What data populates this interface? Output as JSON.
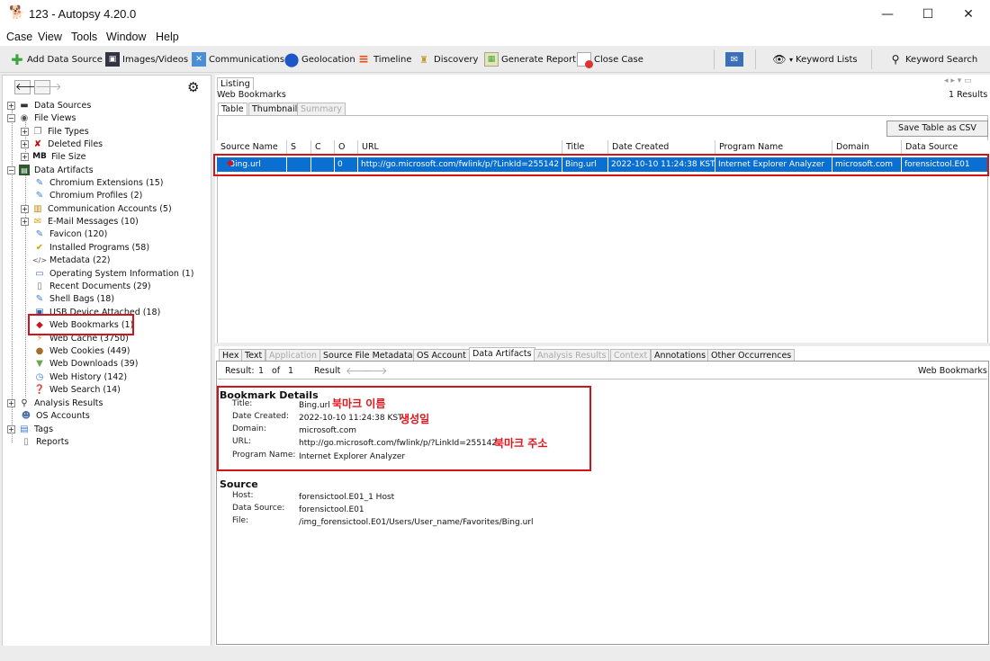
{
  "window": {
    "title": "123 - Autopsy 4.20.0",
    "minimize": "—",
    "maximize": "☐",
    "close": "✕"
  },
  "menu": [
    "Case",
    "View",
    "Tools",
    "Window",
    "Help"
  ],
  "toolbar": {
    "add_data_source": "Add Data Source",
    "images_videos": "Images/Videos",
    "communications": "Communications",
    "geolocation": "Geolocation",
    "timeline": "Timeline",
    "discovery": "Discovery",
    "generate_report": "Generate Report",
    "close_case": "Close Case",
    "keyword_lists": "Keyword Lists",
    "keyword_search": "Keyword Search"
  },
  "tree": {
    "data_sources": "Data Sources",
    "file_views": "File Views",
    "file_types": "File Types",
    "deleted_files": "Deleted Files",
    "file_size": "File Size",
    "file_size_icon": "MB",
    "data_artifacts": "Data Artifacts",
    "chromium_extensions": "Chromium Extensions (15)",
    "chromium_profiles": "Chromium Profiles (2)",
    "communication_accounts": "Communication Accounts (5)",
    "email_messages": "E-Mail Messages (10)",
    "favicon": "Favicon (120)",
    "installed_programs": "Installed Programs (58)",
    "metadata": "Metadata (22)",
    "os_info": "Operating System Information (1)",
    "recent_documents": "Recent Documents (29)",
    "shell_bags": "Shell Bags (18)",
    "usb_device": "USB Device Attached (18)",
    "web_bookmarks": "Web Bookmarks (1)",
    "web_cache": "Web Cache (3750)",
    "web_cookies": "Web Cookies (449)",
    "web_downloads": "Web Downloads (39)",
    "web_history": "Web History (142)",
    "web_search": "Web Search (14)",
    "analysis_results": "Analysis Results",
    "os_accounts": "OS Accounts",
    "tags": "Tags",
    "reports": "Reports"
  },
  "listing": {
    "tab": "Listing",
    "subtitle": "Web Bookmarks",
    "results": "1  Results",
    "view_tabs": [
      "Table",
      "Thumbnail",
      "Summary"
    ],
    "save_csv": "Save Table as CSV",
    "columns": [
      "Source Name",
      "S",
      "C",
      "O",
      "URL",
      "Title",
      "Date Created",
      "Program Name",
      "Domain",
      "Data Source"
    ],
    "row": [
      "Bing.url",
      "",
      "",
      "0",
      "http://go.microsoft.com/fwlink/p/?LinkId=255142",
      "Bing.url",
      "2022-10-10 11:24:38 KST",
      "Internet Explorer Analyzer",
      "microsoft.com",
      "forensictool.E01"
    ]
  },
  "detail": {
    "tabs": [
      "Hex",
      "Text",
      "Application",
      "Source File Metadata",
      "OS Account",
      "Data Artifacts",
      "Analysis Results",
      "Context",
      "Annotations",
      "Other Occurrences"
    ],
    "result_label": "Result:",
    "result_index": "1",
    "result_of": "of",
    "result_total": "1",
    "result_nav": "Result",
    "type": "Web Bookmarks",
    "bookmark_heading": "Bookmark Details",
    "title_label": "Title:",
    "title_value": "Bing.url",
    "date_label": "Date Created:",
    "date_value": "2022-10-10 11:24:38 KST",
    "domain_label": "Domain:",
    "domain_value": "microsoft.com",
    "url_label": "URL:",
    "url_value": "http://go.microsoft.com/fwlink/p/?LinkId=255142",
    "program_label": "Program Name:",
    "program_value": "Internet Explorer Analyzer",
    "source_heading": "Source",
    "host_label": "Host:",
    "host_value": "forensictool.E01_1 Host",
    "ds_label": "Data Source:",
    "ds_value": "forensictool.E01",
    "file_label": "File:",
    "file_value": "/img_forensictool.E01/Users/User_name/Favorites/Bing.url"
  },
  "annotations": {
    "bookmark_name": "북마크 이름",
    "created": "생성일",
    "bookmark_url": "북마크 주소"
  },
  "colors": {
    "selection": "#0a6fd0",
    "annotation_red": "#d0141a"
  }
}
